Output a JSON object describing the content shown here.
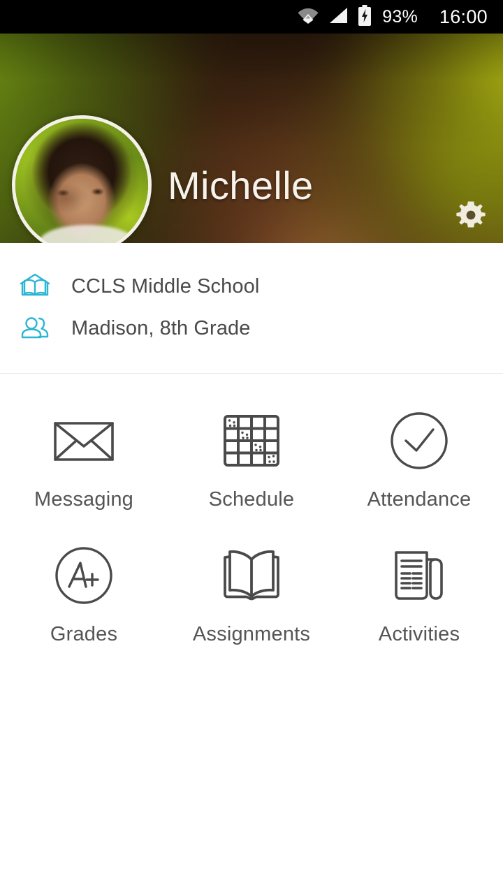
{
  "status_bar": {
    "wifi_icon": "wifi-icon",
    "signal_icon": "cellular-signal-icon",
    "battery_icon": "battery-charging-icon",
    "battery_percent": "93%",
    "time": "16:00",
    "background_color": "#000000",
    "text_color": "#ffffff"
  },
  "header": {
    "avatar_alt": "Michelle profile photo",
    "student_name": "Michelle",
    "settings_label": "Settings",
    "settings_icon": "gear-icon",
    "name_color": "#f7f3ea"
  },
  "info": {
    "rows": [
      {
        "icon": "school-book-icon",
        "text": "CCLS Middle School"
      },
      {
        "icon": "people-icon",
        "text": "Madison, 8th Grade"
      }
    ],
    "icon_color": "#29b6d4",
    "text_color": "#4a4a4a"
  },
  "menu": {
    "items": [
      {
        "label": "Messaging",
        "icon": "envelope-icon"
      },
      {
        "label": "Schedule",
        "icon": "grid-schedule-icon"
      },
      {
        "label": "Attendance",
        "icon": "check-circle-icon"
      },
      {
        "label": "Grades",
        "icon": "a-plus-circle-icon"
      },
      {
        "label": "Assignments",
        "icon": "open-book-icon"
      },
      {
        "label": "Activities",
        "icon": "newspaper-icon"
      }
    ],
    "icon_color": "#4a4a4a",
    "label_color": "#555555"
  }
}
